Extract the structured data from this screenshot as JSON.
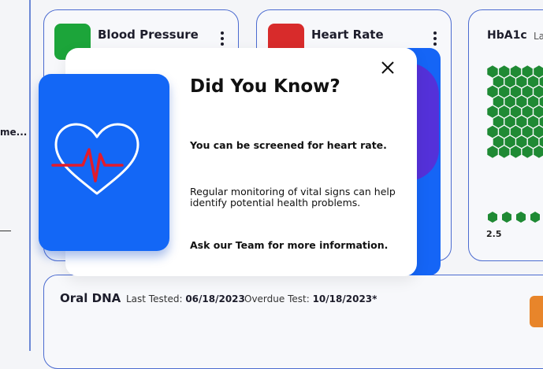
{
  "sidebar": {
    "truncated_item": "me..."
  },
  "cards": {
    "blood_pressure": {
      "title": "Blood Pressure"
    },
    "heart_rate": {
      "title": "Heart Rate"
    },
    "hba1c": {
      "title": "HbA1c",
      "subtitle": "La",
      "scale_label": "2.5"
    },
    "oral_dna": {
      "title": "Oral DNA",
      "last_tested_label": "Last Tested:",
      "last_tested_value": "06/18/2023",
      "overdue_label": "Overdue Test:",
      "overdue_value": "10/18/2023*"
    }
  },
  "modal": {
    "title": "Did You Know?",
    "line1": "You can be screened for heart rate.",
    "paragraph": "Regular monitoring of vital signs can help identify potential health problems.",
    "line3": "Ask our Team for more information."
  },
  "colors": {
    "accent_blue": "#1367f6",
    "bp_green": "#1ca53a",
    "hr_red": "#d82b2b",
    "hex_green": "#1f8a34",
    "dna_orange": "#e8852a"
  }
}
